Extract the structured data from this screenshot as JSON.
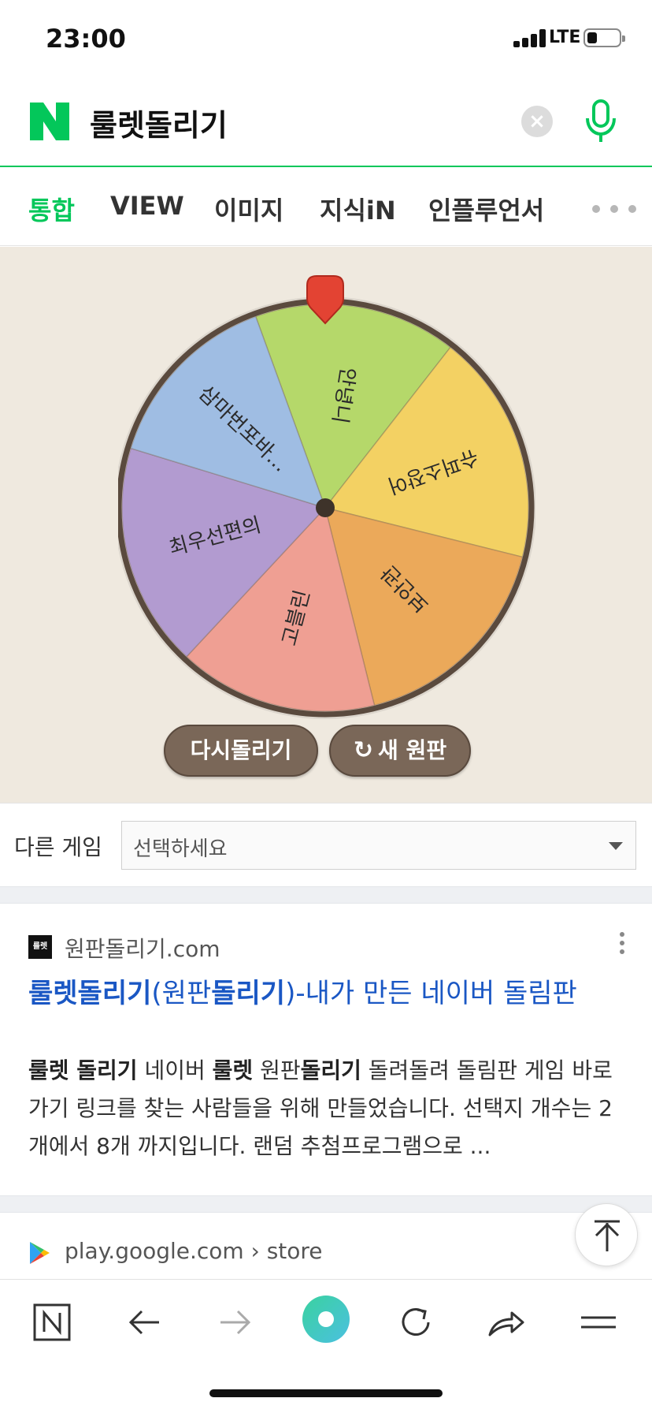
{
  "status_bar": {
    "time": "23:00",
    "network": "LTE"
  },
  "search": {
    "query": "룰렛돌리기",
    "brand_color": "#03c75a"
  },
  "tabs": [
    {
      "label": "통합",
      "active": true
    },
    {
      "label": "VIEW",
      "active": false
    },
    {
      "label": "이미지",
      "active": false
    },
    {
      "label": "지식iN",
      "active": false
    },
    {
      "label": "인플루언서",
      "active": false
    }
  ],
  "roulette": {
    "segments": [
      {
        "label": "안녕니",
        "color": "#b5d86a"
      },
      {
        "label": "슈퍼소장어",
        "color": "#f3d163"
      },
      {
        "label": "보안관",
        "color": "#eba95a"
      },
      {
        "label": "고블린",
        "color": "#ef9f93"
      },
      {
        "label": "최우선편의",
        "color": "#b29bd0"
      },
      {
        "label": "삼마번포바...",
        "color": "#9fbde3"
      }
    ],
    "respin_label": "다시돌리기",
    "new_wheel_label": "새 원판"
  },
  "other_game": {
    "label": "다른 게임",
    "select_value": "선택하세요"
  },
  "results": [
    {
      "favicon_text": "룰렛",
      "site": "원판돌리기.com",
      "title_parts": [
        "룰렛돌리기",
        "(원판",
        "돌리기",
        ")-내가 만든 네이버 돌림판"
      ],
      "snippet_parts": [
        "룰렛 돌리기",
        " 네이버 ",
        "룰렛",
        " 원판",
        "돌리기",
        " 돌려돌려 돌림판 게임 바로가기 링크를 찾는 사람들을 위해 만들었습니다. 선택지 개수는 2개에서 8개 까지입니다. 랜덤 추첨프로그램으로 ..."
      ]
    },
    {
      "site": "play.google.com › store"
    }
  ]
}
